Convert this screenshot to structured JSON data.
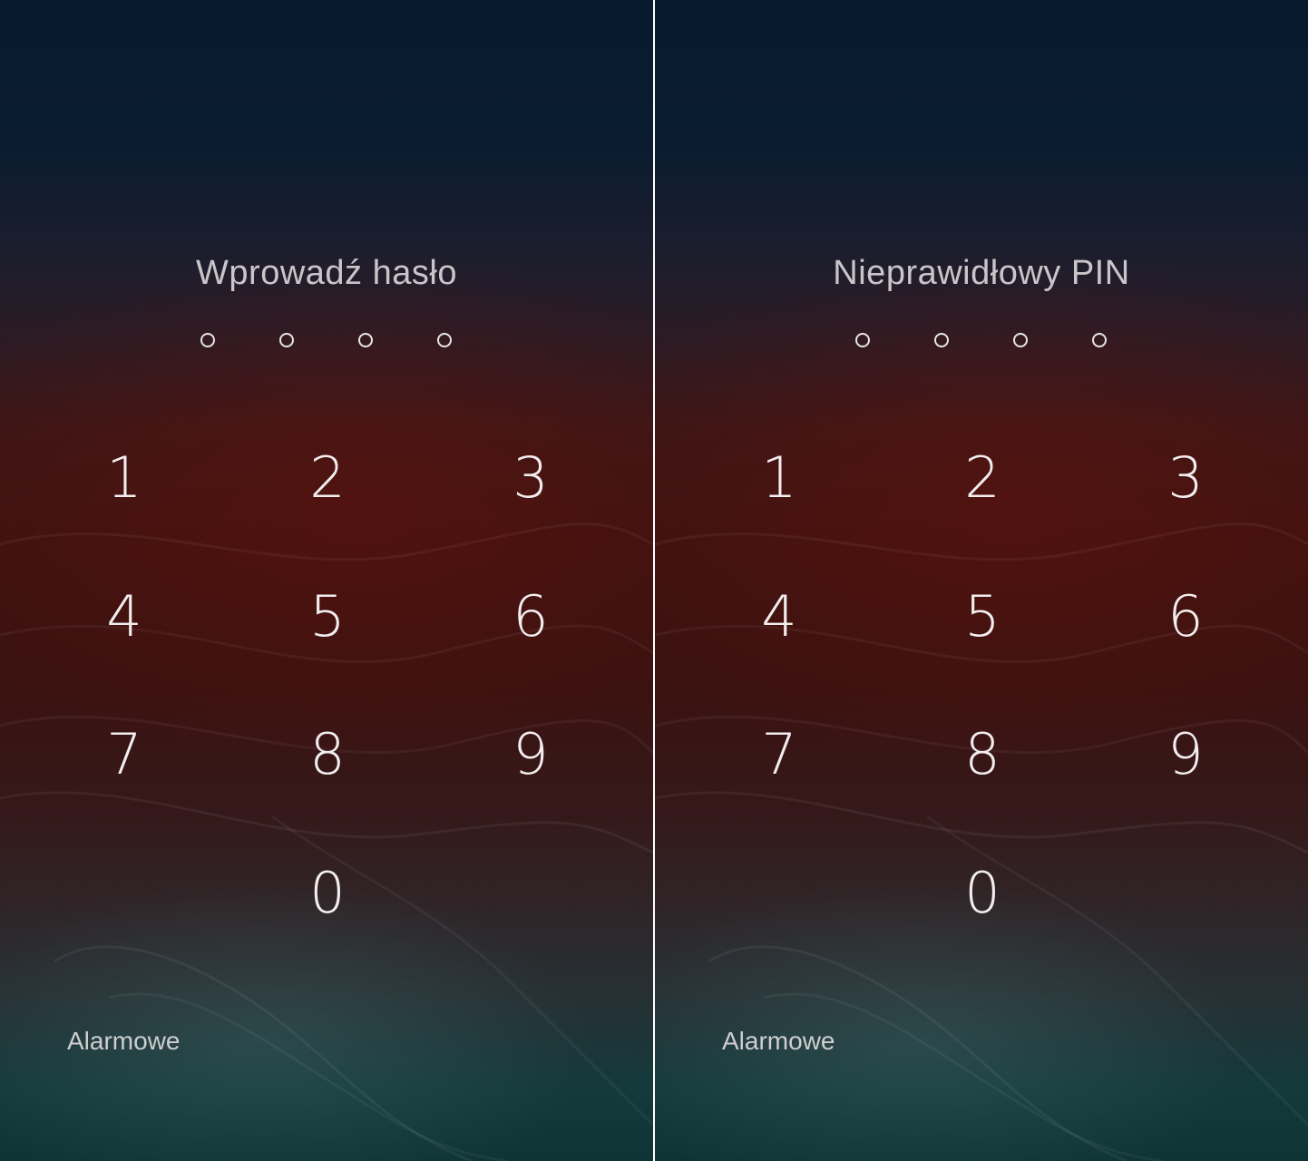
{
  "screens": [
    {
      "title": "Wprowadź hasło",
      "pin_dots": 4,
      "keys": [
        "1",
        "2",
        "3",
        "4",
        "5",
        "6",
        "7",
        "8",
        "9",
        "0"
      ],
      "emergency_label": "Alarmowe"
    },
    {
      "title": "Nieprawidłowy PIN",
      "pin_dots": 4,
      "keys": [
        "1",
        "2",
        "3",
        "4",
        "5",
        "6",
        "7",
        "8",
        "9",
        "0"
      ],
      "emergency_label": "Alarmowe"
    }
  ]
}
